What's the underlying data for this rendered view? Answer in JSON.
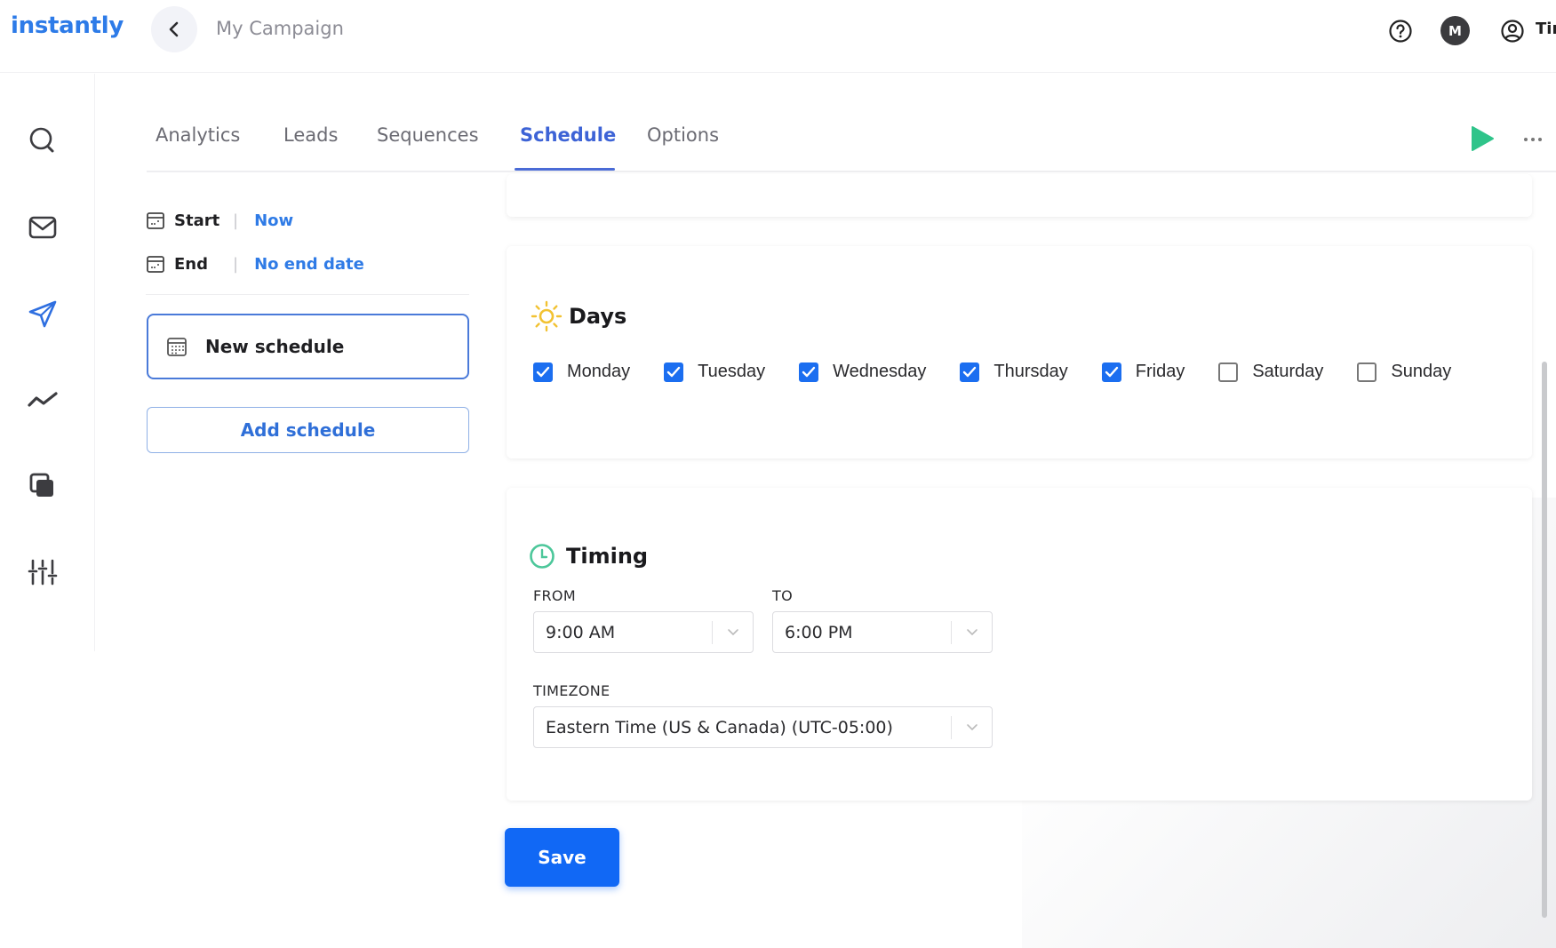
{
  "app": {
    "logo": "instantly",
    "campaign_title": "My Campaign",
    "avatar_initial": "M",
    "user_name": "Tim",
    "accent_color": "#1168f5"
  },
  "sidebar": {
    "items": [
      {
        "icon": "search-icon"
      },
      {
        "icon": "mail-icon"
      },
      {
        "icon": "send-icon",
        "active": true
      },
      {
        "icon": "analytics-icon"
      },
      {
        "icon": "copy-icon"
      },
      {
        "icon": "settings-sliders-icon"
      }
    ]
  },
  "tabs": [
    {
      "label": "Analytics"
    },
    {
      "label": "Leads"
    },
    {
      "label": "Sequences"
    },
    {
      "label": "Schedule",
      "active": true
    },
    {
      "label": "Options"
    }
  ],
  "schedule_panel": {
    "start_label": "Start",
    "start_value": "Now",
    "end_label": "End",
    "end_value": "No end date",
    "schedules": [
      {
        "name": "New schedule",
        "selected": true
      }
    ],
    "add_schedule_label": "Add schedule"
  },
  "days": {
    "title": "Days",
    "items": [
      {
        "name": "Monday",
        "checked": true
      },
      {
        "name": "Tuesday",
        "checked": true
      },
      {
        "name": "Wednesday",
        "checked": true
      },
      {
        "name": "Thursday",
        "checked": true
      },
      {
        "name": "Friday",
        "checked": true
      },
      {
        "name": "Saturday",
        "checked": false
      },
      {
        "name": "Sunday",
        "checked": false
      }
    ]
  },
  "timing": {
    "title": "Timing",
    "from_label": "FROM",
    "from_value": "9:00 AM",
    "to_label": "TO",
    "to_value": "6:00 PM",
    "timezone_label": "TIMEZONE",
    "timezone_value": "Eastern Time (US & Canada) (UTC-05:00)"
  },
  "save_label": "Save"
}
